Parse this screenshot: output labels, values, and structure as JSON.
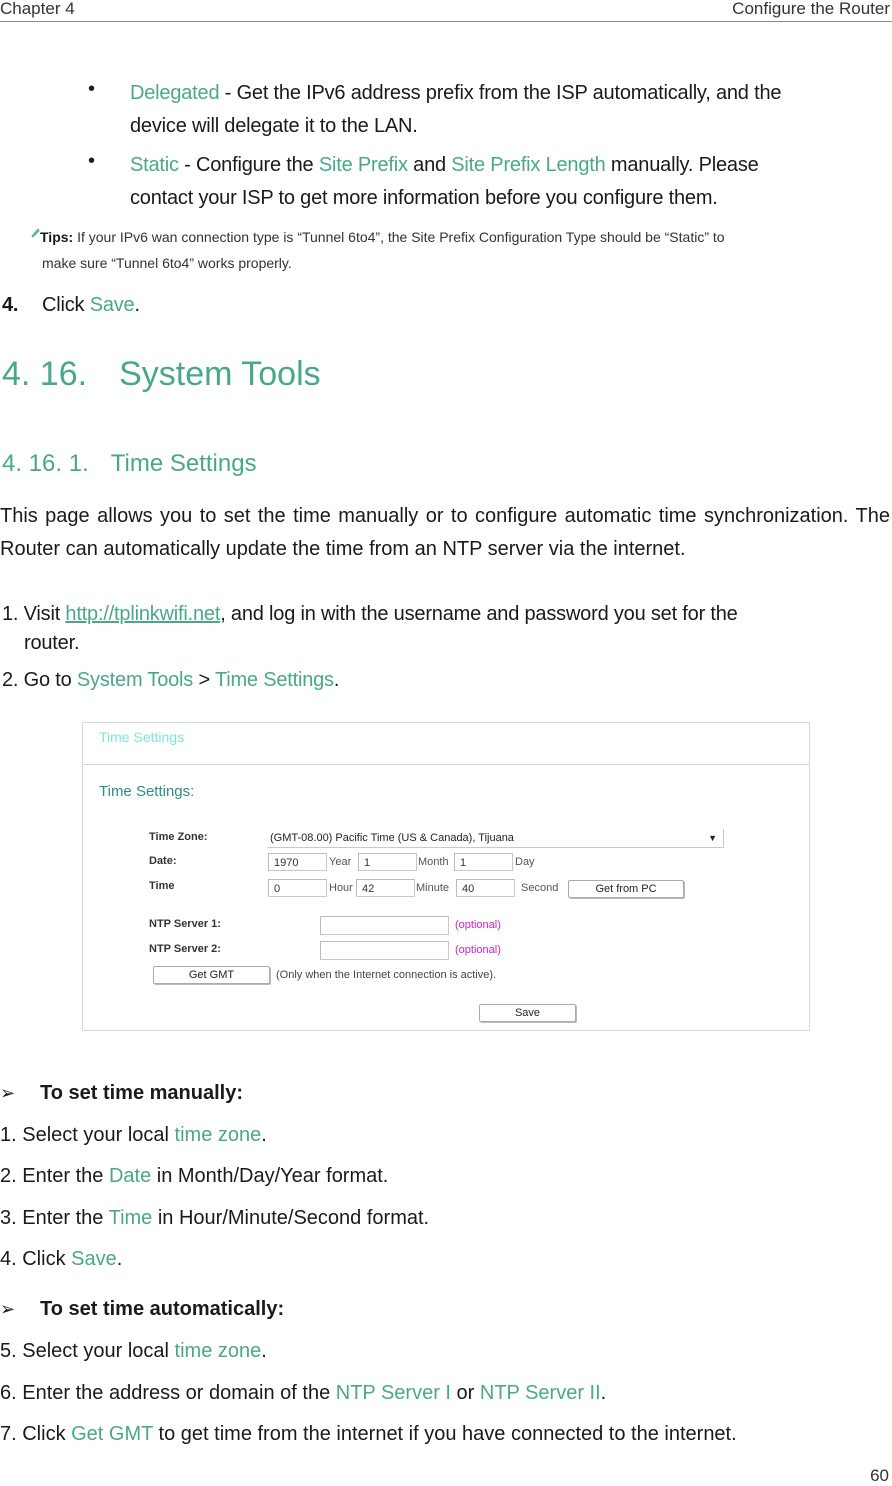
{
  "header": {
    "chapter": "Chapter 4",
    "section": "Configure the Router"
  },
  "bullets": [
    {
      "term": "Delegated",
      "rest_line1": " - Get the IPv6 address prefix from the ISP automatically, and the",
      "line2": "device will delegate it to the LAN."
    },
    {
      "term": "Static",
      "mid1": " - Configure the ",
      "term2": "Site Prefix",
      "mid2": " and ",
      "term3": "Site Prefix Length",
      "mid3": " manually. Please",
      "line2": "contact your ISP to get more information before you configure them."
    }
  ],
  "tips": {
    "icon": "paperclip-icon",
    "label": "Tips:",
    "line1": " If your IPv6 wan connection type is “Tunnel 6to4”, the Site Prefix Configuration Type should be “Static” to",
    "line2": "make sure “Tunnel 6to4” works properly."
  },
  "step4": {
    "num": "4.",
    "pre": "Click ",
    "link": "Save",
    "post": "."
  },
  "section": {
    "number": "4. 16.",
    "title": "System Tools"
  },
  "subsection": {
    "number": "4. 16. 1.",
    "title": "Time Settings"
  },
  "intro": "This page allows you to set the time manually or to configure automatic time synchronization. The Router can automatically update the time from an NTP server via the internet.",
  "visit": {
    "pre": "1. Visit ",
    "link": "http://tplinkwifi.net",
    "post": ", and log in with the username and password you set for the",
    "line2": "router."
  },
  "goto": {
    "pre": "2. Go to ",
    "link1": "System Tools",
    "sep": " > ",
    "link2": "Time Settings",
    "post": "."
  },
  "router_ui": {
    "panel_title": "Time Settings",
    "section_title": "Time Settings:",
    "time_zone_label": "Time Zone:",
    "time_zone_value": "(GMT-08.00) Pacific Time (US & Canada), Tijuana",
    "date_label": "Date:",
    "date": {
      "year": "1970",
      "year_unit": "Year",
      "month": "1",
      "month_unit": "Month",
      "day": "1",
      "day_unit": "Day"
    },
    "time_label": "Time",
    "time": {
      "hour": "0",
      "hour_unit": "Hour",
      "minute": "42",
      "minute_unit": "Minute",
      "second": "40",
      "second_unit": "Second"
    },
    "get_from_pc": "Get from PC",
    "ntp1_label": "NTP Server 1:",
    "ntp1_value": "",
    "ntp2_label": "NTP Server 2:",
    "ntp2_value": "",
    "optional": "(optional)",
    "get_gmt": "Get GMT",
    "gmt_note": "(Only when the Internet connection is active).",
    "save": "Save"
  },
  "manual": {
    "heading": "To set time manually:",
    "steps": [
      {
        "pre": "1. Select your local ",
        "link": "time zone",
        "post": "."
      },
      {
        "pre": "2. Enter the ",
        "link": "Date",
        "post": " in Month/Day/Year format."
      },
      {
        "pre": "3. Enter the ",
        "link": "Time",
        "post": " in Hour/Minute/Second format."
      },
      {
        "pre": "4. Click ",
        "link": "Save",
        "post": "."
      }
    ]
  },
  "automatic": {
    "heading": "To set time automatically:",
    "steps": [
      {
        "pre": "5. Select your local ",
        "link": "time zone",
        "post": "."
      },
      {
        "pre": "6. Enter the address or domain of the ",
        "link": "NTP Server I",
        "mid": " or ",
        "link2": "NTP Server II",
        "post": "."
      },
      {
        "pre": "7. Click ",
        "link": "Get GMT",
        "post": " to get time from the internet if you have connected to the internet."
      }
    ]
  },
  "page_number": "60",
  "colors": {
    "accent": "#4aa88a",
    "optional": "#d020d0",
    "panel_title": "#7ee6d6"
  }
}
